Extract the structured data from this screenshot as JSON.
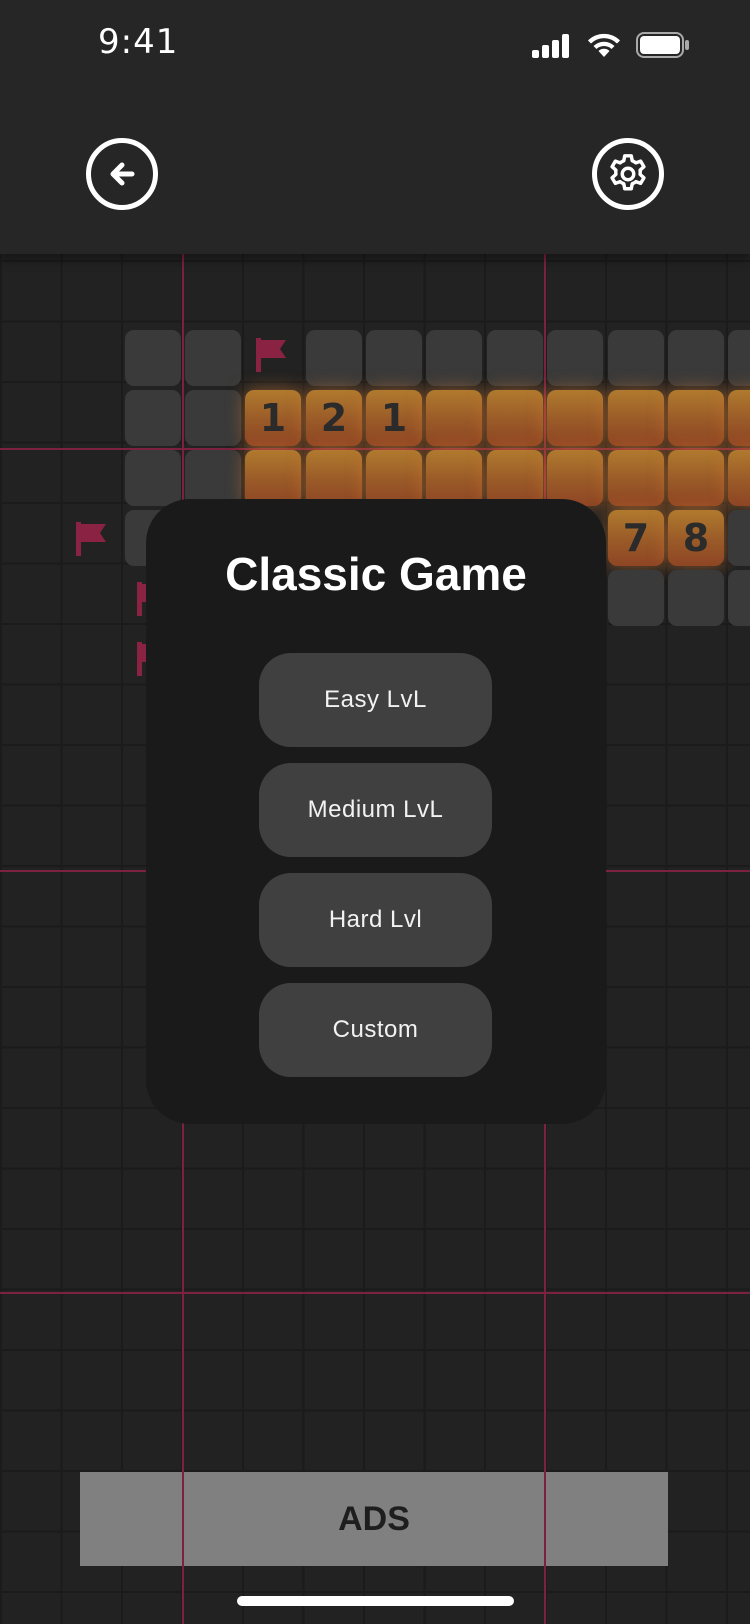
{
  "status": {
    "time": "9:41"
  },
  "header": {
    "back_icon": "back-arrow-icon",
    "settings_icon": "gear-icon"
  },
  "board": {
    "numbers": [
      "1",
      "2",
      "1",
      "7",
      "8"
    ]
  },
  "modal": {
    "title": "Classic Game",
    "options": [
      "Easy LvL",
      "Medium LvL",
      "Hard Lvl",
      "Custom"
    ]
  },
  "ads": {
    "label": "ADS"
  },
  "colors": {
    "tile_highlight": "#b07a2e",
    "flag": "#8a2244",
    "grid_line": "#7c2140",
    "modal_bg": "#1a1a1a",
    "button_bg": "#404040"
  }
}
